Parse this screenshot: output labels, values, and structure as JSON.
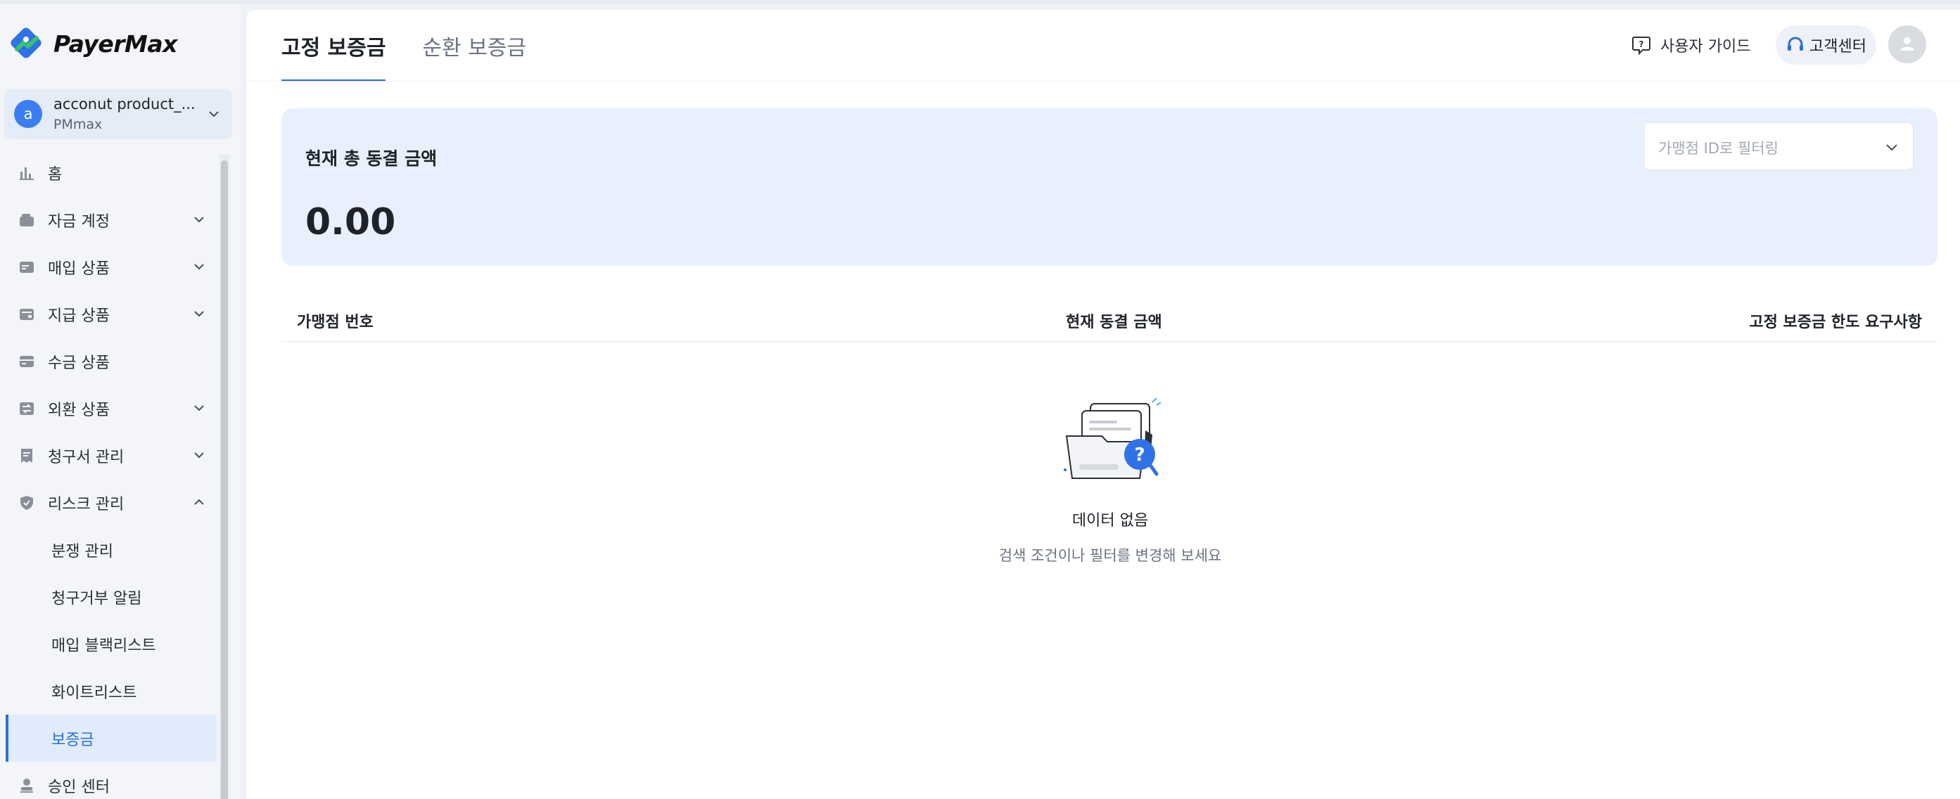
{
  "app": {
    "logo_text": "PayerMax"
  },
  "account": {
    "initial": "a",
    "name": "acconut product_...",
    "sub": "PMmax"
  },
  "sidebar": {
    "items": [
      {
        "label": "홈",
        "icon": "bar-chart-icon"
      },
      {
        "label": "자금 계정",
        "icon": "wallet-icon"
      },
      {
        "label": "매입 상품",
        "icon": "card-icon"
      },
      {
        "label": "지급 상품",
        "icon": "payout-icon"
      },
      {
        "label": "수금 상품",
        "icon": "collect-icon"
      },
      {
        "label": "외환 상품",
        "icon": "fx-icon"
      },
      {
        "label": "청구서 관리",
        "icon": "invoice-icon"
      },
      {
        "label": "리스크 관리",
        "icon": "shield-icon"
      }
    ],
    "risk_sub": [
      "분쟁 관리",
      "청구거부 알림",
      "매입 블랙리스트",
      "화이트리스트",
      "보증금"
    ],
    "after": {
      "label": "승인 센터",
      "icon": "approval-icon"
    }
  },
  "tabs": [
    {
      "label": "고정 보증금"
    },
    {
      "label": "순환 보증금"
    }
  ],
  "header": {
    "guide_label": "사용자 가이드",
    "support_label": "고객센터"
  },
  "summary": {
    "label": "현재 총 동결 금액",
    "value": "0.00",
    "filter_placeholder": "가맹점 ID로 필터링"
  },
  "table": {
    "columns": [
      "가맹점 번호",
      "현재 동결 금액",
      "고정 보증금 한도 요구사항"
    ]
  },
  "empty": {
    "title": "데이터 없음",
    "desc": "검색 조건이나 필터를 변경해 보세요"
  },
  "colors": {
    "accent": "#2a6fdb",
    "card_bg": "#e8f0fe",
    "sidebar_bg": "#f3f5f8"
  }
}
